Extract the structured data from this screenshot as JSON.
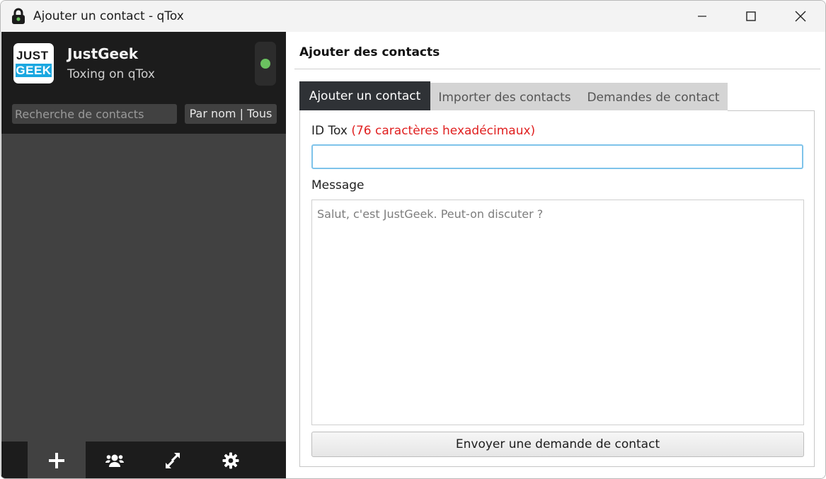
{
  "window": {
    "title": "Ajouter un contact - qTox",
    "controls": [
      "minimize",
      "maximize",
      "close"
    ]
  },
  "profile": {
    "avatar_text_top": "JUST",
    "avatar_text_bottom": "GEEK",
    "name": "JustGeek",
    "status_message": "Toxing on qTox",
    "status": "online",
    "status_color": "#6bc260"
  },
  "sidebar": {
    "search_placeholder": "Recherche de contacts",
    "filter_label": "Par nom | Tous",
    "bottom_buttons": [
      {
        "name": "add-contact",
        "icon": "plus-icon",
        "active": true
      },
      {
        "name": "create-group",
        "icon": "group-icon",
        "active": false
      },
      {
        "name": "file-transfers",
        "icon": "transfer-arrows-icon",
        "active": false
      },
      {
        "name": "settings",
        "icon": "gear-icon",
        "active": false
      }
    ]
  },
  "main": {
    "title": "Ajouter des contacts",
    "tabs": [
      {
        "label": "Ajouter un contact",
        "active": true
      },
      {
        "label": "Importer des contacts",
        "active": false
      },
      {
        "label": "Demandes de contact",
        "active": false
      }
    ],
    "id_label": "ID Tox",
    "id_hint": "(76 caractères hexadécimaux)",
    "id_value": "",
    "message_label": "Message",
    "message_placeholder": "Salut, c'est JustGeek. Peut-on discuter ?",
    "send_button": "Envoyer une demande de contact"
  },
  "colors": {
    "sidebar_dark": "#1c1c1c",
    "sidebar_mid": "#414141",
    "active_tab": "#2f3236",
    "hint_red": "#e02020",
    "input_focus": "#7ec3ea"
  }
}
